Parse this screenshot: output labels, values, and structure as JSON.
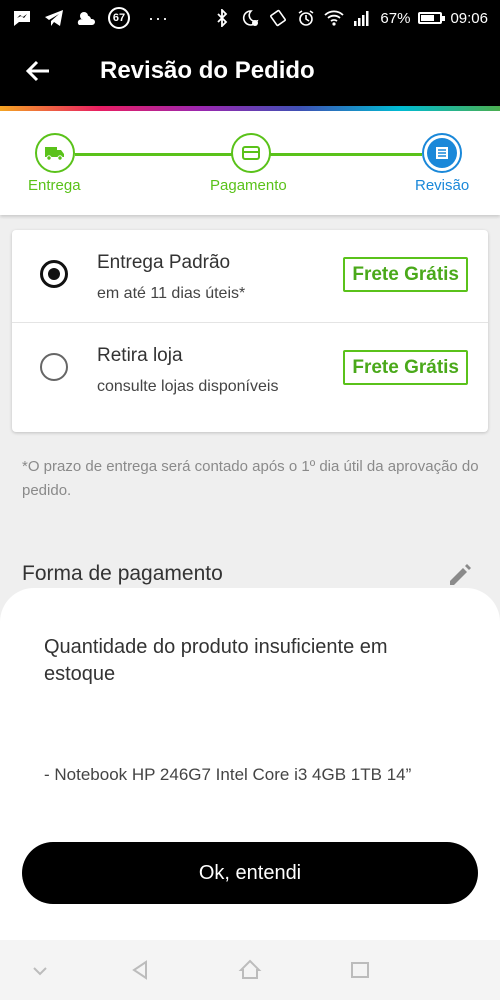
{
  "status_bar": {
    "notification_count": "67",
    "dots": "···",
    "battery_percent": "67%",
    "battery_level": 0.67,
    "time": "09:06",
    "left_icons": [
      "messenger-icon",
      "telegram-icon",
      "weather-icon",
      "notification-count-badge"
    ],
    "right_icons": [
      "bluetooth-icon",
      "do-not-disturb-icon",
      "vibrate-icon",
      "alarm-icon",
      "wifi-icon",
      "signal-icon",
      "battery-icon"
    ]
  },
  "app_bar": {
    "title": "Revisão do Pedido",
    "back_icon": "arrow-left-icon"
  },
  "stepper": {
    "steps": [
      {
        "label": "Entrega",
        "icon": "truck-icon",
        "state": "done"
      },
      {
        "label": "Pagamento",
        "icon": "credit-card-icon",
        "state": "done"
      },
      {
        "label": "Revisão",
        "icon": "document-icon",
        "state": "current"
      }
    ]
  },
  "shipping": {
    "options": [
      {
        "title": "Entrega Padrão",
        "subtitle": "em até 11 dias úteis*",
        "price": "Frete Grátis",
        "selected": true
      },
      {
        "title": "Retira loja",
        "subtitle": "consulte lojas disponíveis",
        "price": "Frete Grátis",
        "selected": false
      }
    ],
    "note": "*O prazo de entrega será contado após o 1º dia útil da aprovação do pedido."
  },
  "payment": {
    "title": "Forma de pagamento",
    "edit_icon": "pencil-icon"
  },
  "dialog": {
    "message": "Quantidade do produto insuficiente em estoque",
    "item": "- Notebook HP 246G7 Intel Core i3 4GB 1TB 14”",
    "button": "Ok, entendi"
  },
  "nav_bar": {
    "icons": [
      "hide-keyboard-icon",
      "back-icon",
      "home-icon",
      "recents-icon"
    ]
  },
  "colors": {
    "accent_green": "#5ac21a",
    "accent_blue": "#1a88d9",
    "black": "#000000"
  }
}
